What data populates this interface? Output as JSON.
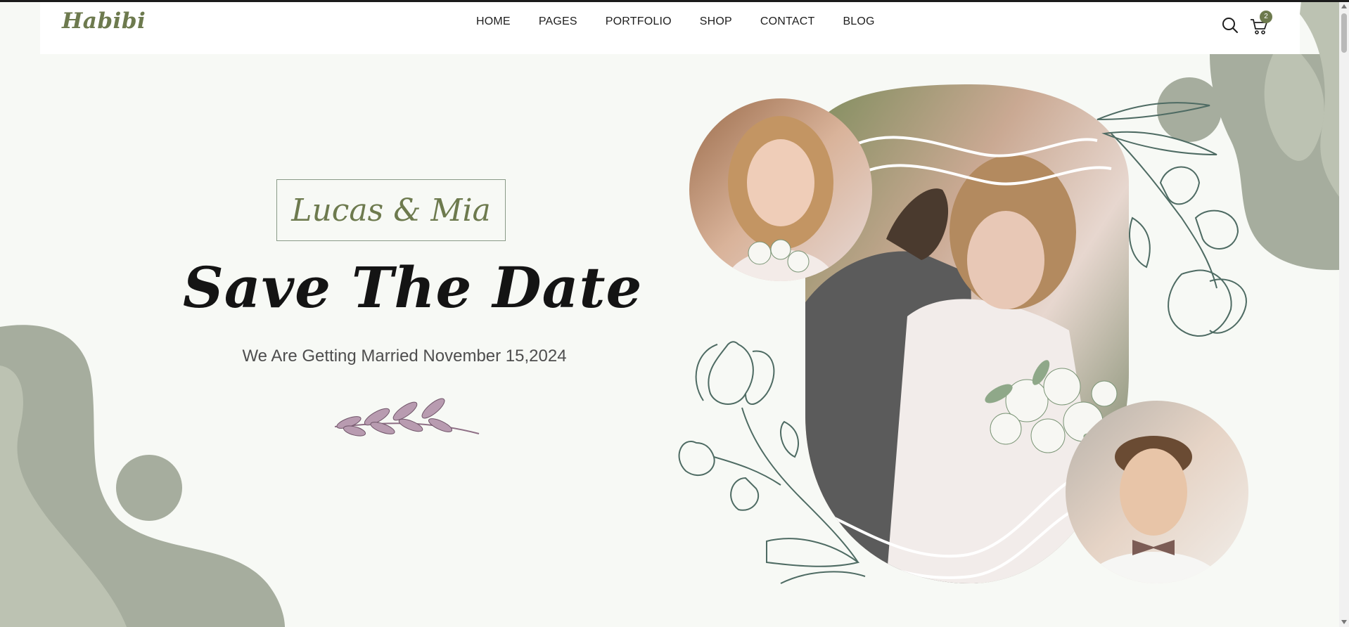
{
  "brand": {
    "logo_text": "Habibi",
    "accent": "#6d7a4e"
  },
  "nav": {
    "items": [
      {
        "label": "HOME"
      },
      {
        "label": "PAGES"
      },
      {
        "label": "PORTFOLIO"
      },
      {
        "label": "SHOP"
      },
      {
        "label": "CONTACT"
      },
      {
        "label": "BLOG"
      }
    ]
  },
  "header_icons": {
    "search": "search-icon",
    "cart": "cart-icon",
    "cart_count": "2"
  },
  "hero": {
    "couple_names": "Lucas & Mia",
    "headline": "Save The Date",
    "subline": "We Are Getting Married November 15,2024"
  },
  "colors": {
    "page_bg": "#f7f9f5",
    "blob_dark": "#a6ad9e",
    "blob_light": "#bcc2b2",
    "line_art": "#4e6b63"
  }
}
